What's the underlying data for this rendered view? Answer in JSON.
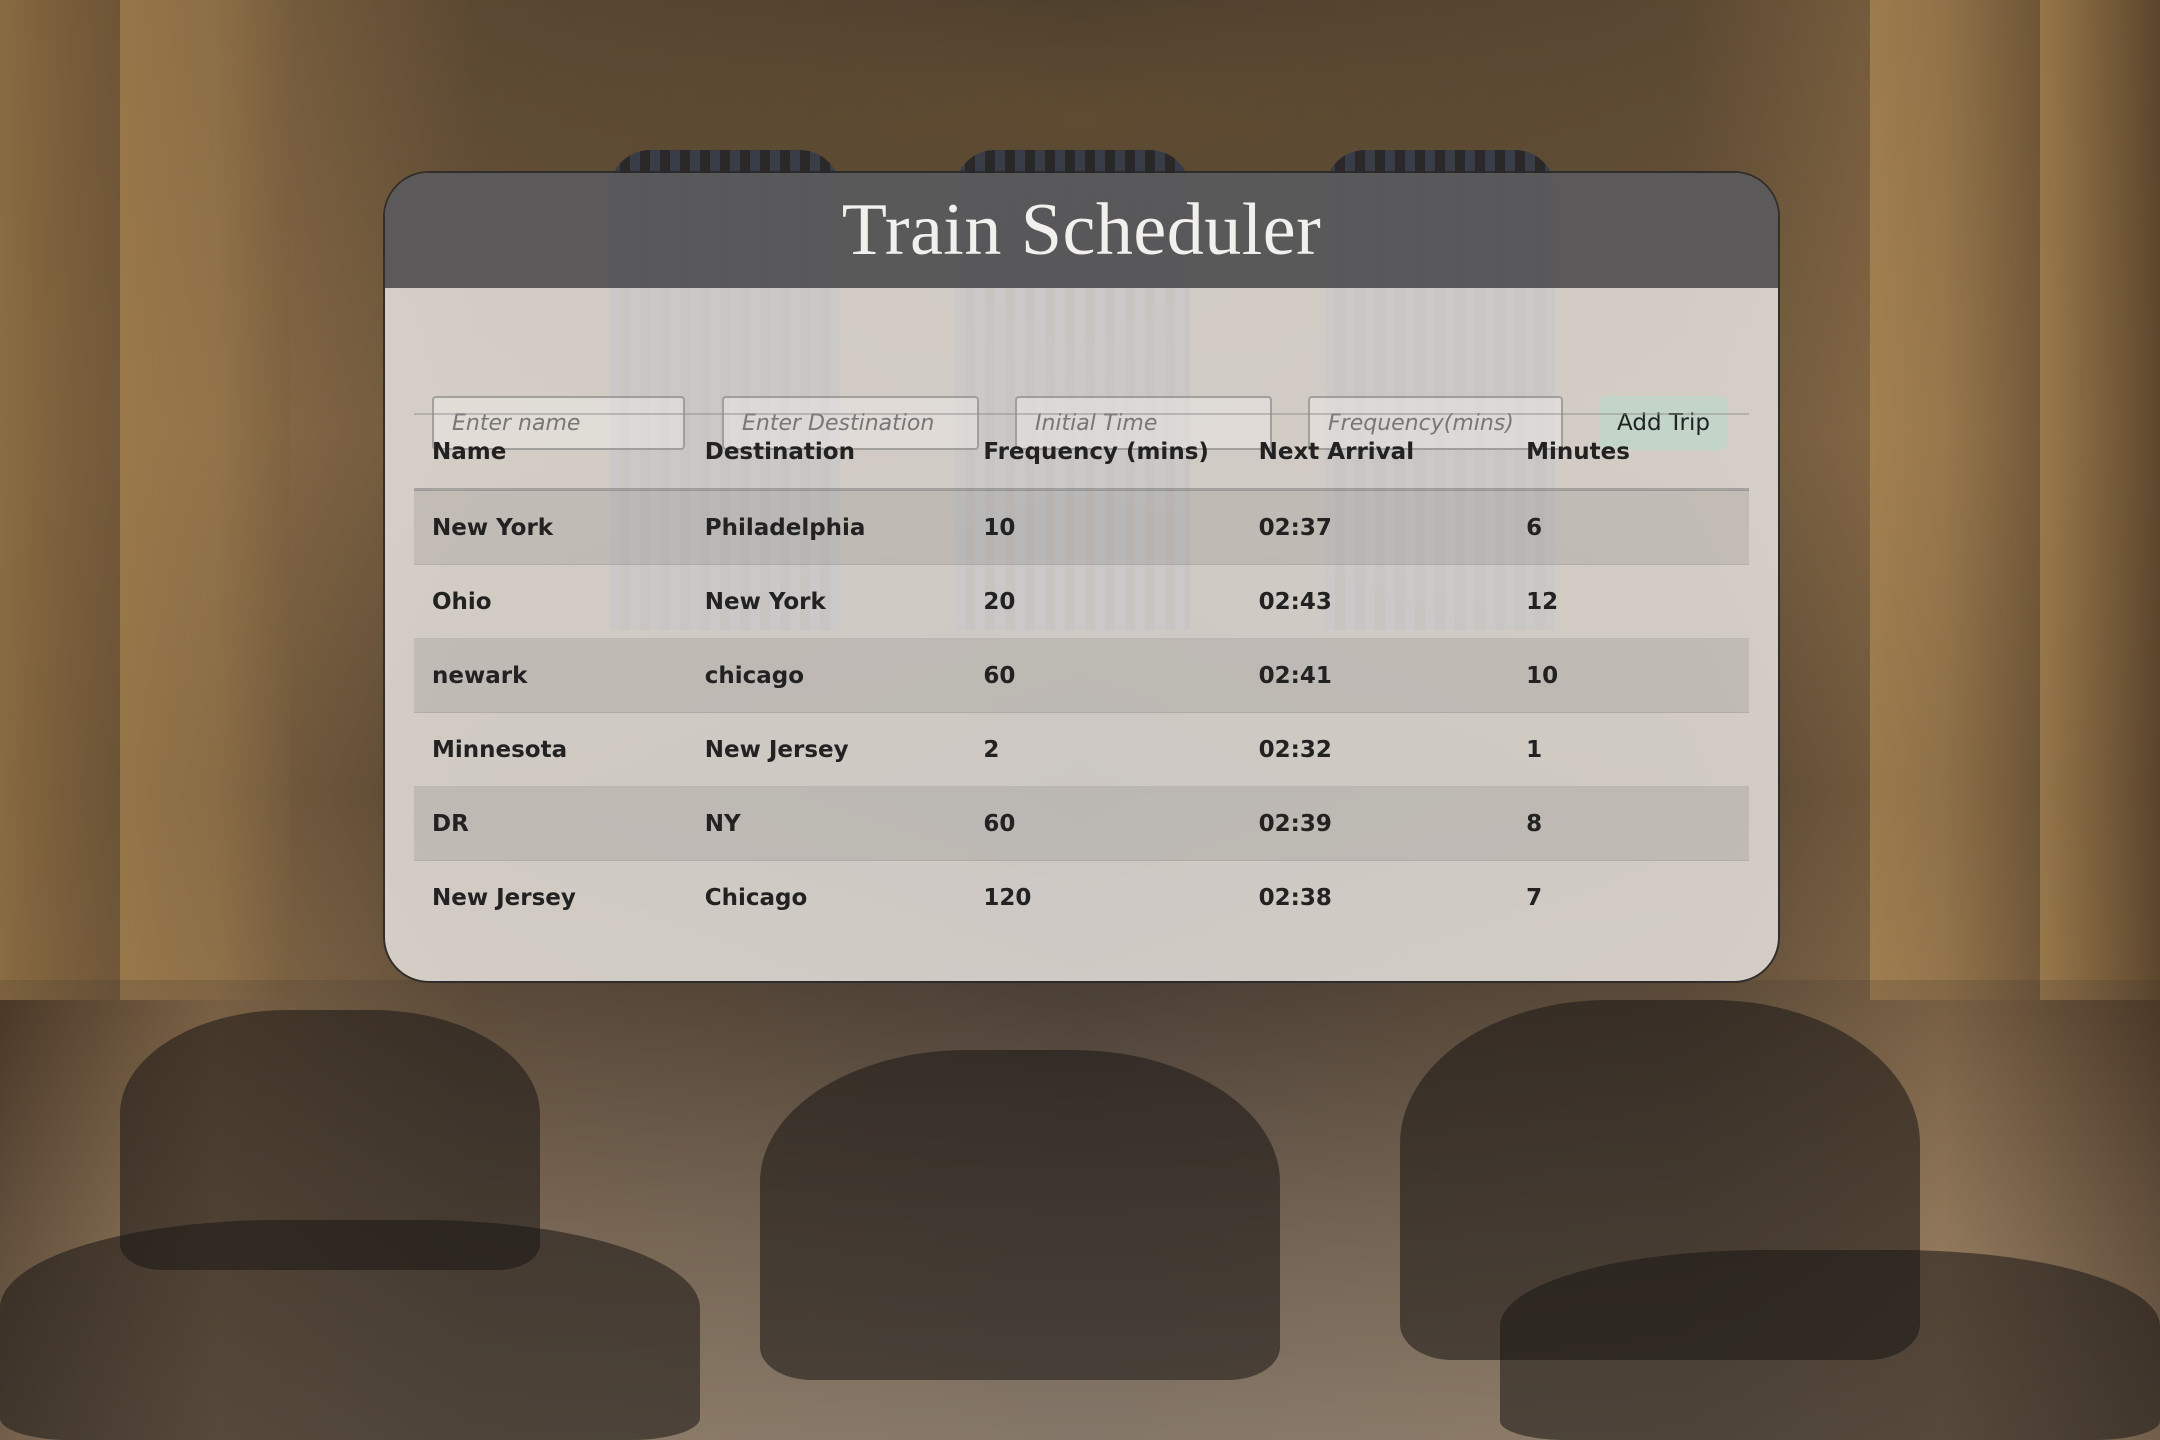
{
  "app": {
    "title": "Train Scheduler"
  },
  "form": {
    "name_placeholder": "Enter name",
    "destination_placeholder": "Enter Destination",
    "time_placeholder": "Initial Time",
    "frequency_placeholder": "Frequency(mins)",
    "add_button_label": "Add Trip"
  },
  "table": {
    "headers": [
      "Name",
      "Destination",
      "Frequency (mins)",
      "Next Arrival",
      "Minutes"
    ],
    "rows": [
      [
        "New York",
        "Philadelphia",
        "10",
        "02:37",
        "6"
      ],
      [
        "Ohio",
        "New York",
        "20",
        "02:43",
        "12"
      ],
      [
        "newark",
        "chicago",
        "60",
        "02:41",
        "10"
      ],
      [
        "Minnesota",
        "New Jersey",
        "2",
        "02:32",
        "1"
      ],
      [
        "DR",
        "NY",
        "60",
        "02:39",
        "8"
      ],
      [
        "New Jersey",
        "Chicago",
        "120",
        "02:38",
        "7"
      ]
    ]
  }
}
